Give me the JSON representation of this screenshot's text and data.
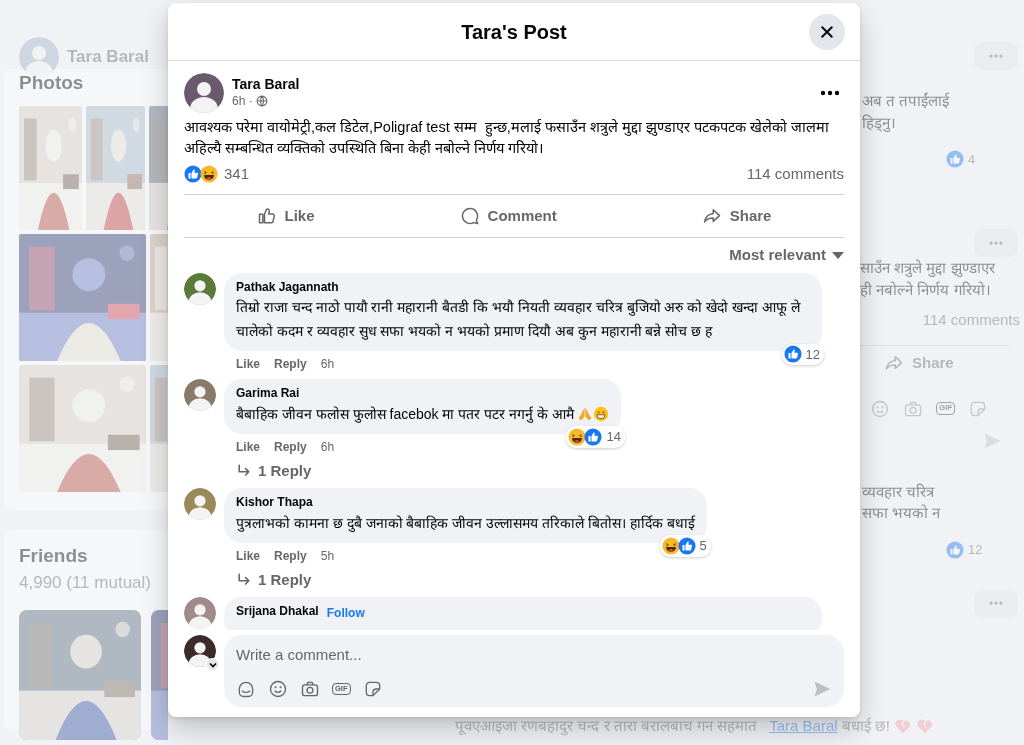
{
  "background": {
    "profile_bar": {
      "name": "Tara Baral"
    },
    "photos": {
      "title": "Photos"
    },
    "friends": {
      "title": "Friends",
      "count": "4,990 (11 mutual)"
    },
    "feed": [
      {
        "kind": "menu"
      },
      {
        "kind": "comment",
        "lines": [
          "अब त तपाईंलाई",
          "हिड्नु।"
        ],
        "reaction_count": "4"
      },
      {
        "kind": "menu"
      },
      {
        "kind": "post",
        "lines": [
          "साउँन शत्रुले मुद्दा झुण्डाएर",
          "ही नबोल्ने निर्णय गरियो।"
        ],
        "comments_count": "114 comments",
        "share": "Share",
        "tools": [
          {
            "kind": "emoji"
          },
          {
            "kind": "camera"
          },
          {
            "kind": "gif",
            "label": "GIF"
          },
          {
            "kind": "sticker"
          }
        ]
      },
      {
        "kind": "comment",
        "lines": [
          "व्यवहार चरित्र",
          "सफा भयको न"
        ],
        "reaction_count": "12"
      },
      {
        "kind": "menu"
      }
    ],
    "bottom_line": {
      "text": "पूवएआइजा रणबहादुर चन्द र तारा बरालबाच गन सहमात",
      "mention": "Tara Baral",
      "end": "बधाई छ!"
    }
  },
  "modal": {
    "title": "Tara's Post",
    "post": {
      "author": "Tara Baral",
      "time": "6h ·",
      "text": "आवश्यक परेमा वायोमेट्री,कल डिटेल,Poligraf test सम्म  हुन्छ,मलाई फसाउँन शत्रुले मुद्दा झुण्डाएर पटकपटक खेलेको जालमा अहिल्यै सम्बन्धित व्यक्तिको उपस्थिति बिना केही नबोल्ने निर्णय गरियो।",
      "reactions": [
        {
          "kind": "like"
        },
        {
          "kind": "haha"
        }
      ],
      "reaction_count": "341",
      "comments_count": "114 comments",
      "actions": [
        {
          "kind": "like",
          "label": "Like"
        },
        {
          "kind": "comment",
          "label": "Comment"
        },
        {
          "kind": "share",
          "label": "Share"
        }
      ]
    },
    "sort": "Most relevant",
    "comments": [
      {
        "author": "Pathak Jagannath",
        "text": "तिम्रो राजा चन्द नाठो पायौ रानी महारानी बैतडी कि भयौ नियती व्यवहार चरित्र बुजियो अरु को खेदो खन्दा आफू ले चालेको कदम र व्यवहार सुध सफा भयको न भयको प्रमाण दियौ अब कुन महारानी बन्ने सोच छ ह",
        "like": "Like",
        "reply": "Reply",
        "time": "6h",
        "reactions": [
          {
            "kind": "like"
          }
        ],
        "reaction_count": "12"
      },
      {
        "author": "Garima Rai",
        "text": "बैबाहिक जीवन फलोस फुलोस facebok मा पतर पटर नगर्नु के आमै",
        "end_icons": [
          {
            "kind": "pray"
          },
          {
            "kind": "grin"
          }
        ],
        "like": "Like",
        "reply": "Reply",
        "time": "6h",
        "reactions": [
          {
            "kind": "haha"
          },
          {
            "kind": "like"
          }
        ],
        "reaction_count": "14",
        "replies": "1 Reply"
      },
      {
        "author": "Kishor Thapa",
        "text": "पुत्रलाभको कामना छ दुबै जनाको बैबाहिक जीवन उल्लासमय तरिकाले बितोस। हार्दिक बधाई",
        "like": "Like",
        "reply": "Reply",
        "time": "5h",
        "reactions": [
          {
            "kind": "haha"
          },
          {
            "kind": "like"
          }
        ],
        "reaction_count": "5",
        "replies": "1 Reply"
      },
      {
        "author": "Srijana Dhakal",
        "follow": "Follow"
      }
    ],
    "composer": {
      "placeholder": "Write a comment...",
      "tools": [
        {
          "kind": "avatar"
        },
        {
          "kind": "emoji"
        },
        {
          "kind": "camera"
        },
        {
          "kind": "gif",
          "label": "GIF"
        },
        {
          "kind": "sticker"
        }
      ]
    }
  }
}
